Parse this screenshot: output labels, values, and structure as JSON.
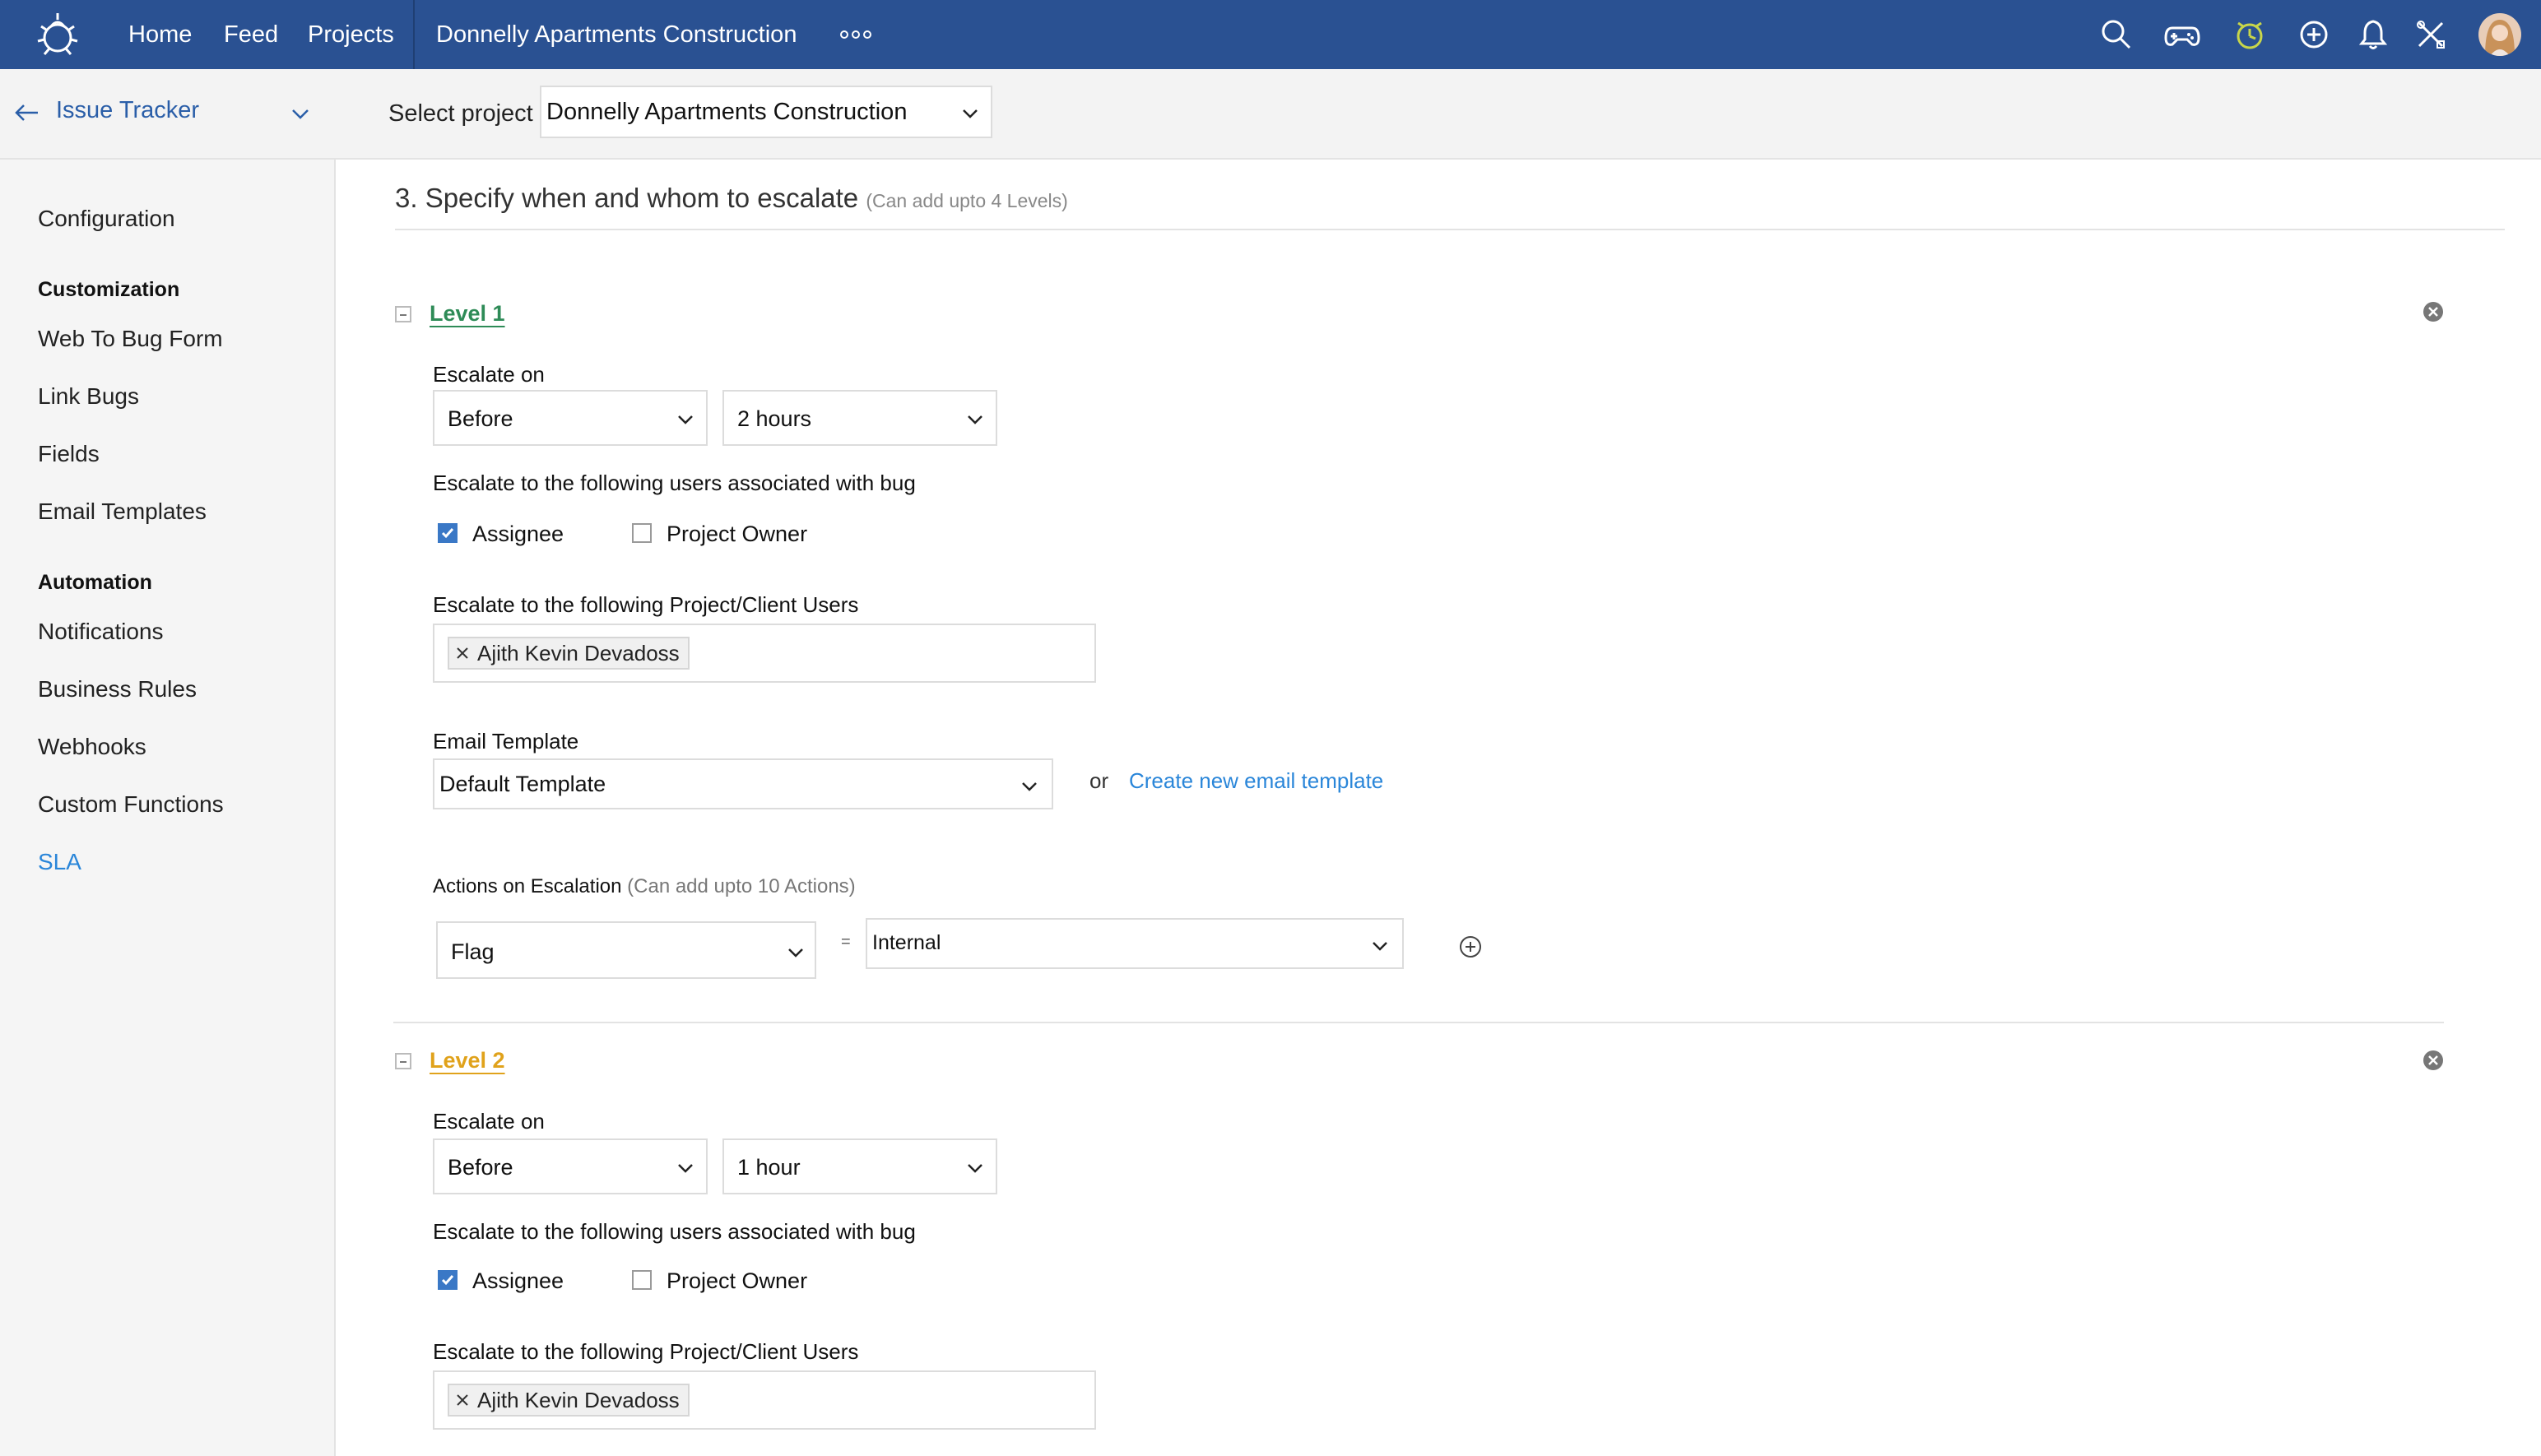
{
  "topbar": {
    "nav": [
      "Home",
      "Feed",
      "Projects"
    ],
    "project_title": "Donnelly Apartments Construction",
    "icons": [
      "search-icon",
      "gamepad-icon",
      "timer-icon",
      "add-icon",
      "bell-icon",
      "tools-icon",
      "avatar"
    ]
  },
  "subheader": {
    "tracker_label": "Issue Tracker",
    "select_label": "Select project",
    "selected_project": "Donnelly Apartments Construction"
  },
  "sidebar": {
    "configuration": "Configuration",
    "customization_heading": "Customization",
    "customization_items": [
      "Web To Bug Form",
      "Link Bugs",
      "Fields",
      "Email Templates"
    ],
    "automation_heading": "Automation",
    "automation_items": [
      "Notifications",
      "Business Rules",
      "Webhooks",
      "Custom Functions",
      "SLA"
    ],
    "active": "SLA"
  },
  "main": {
    "section_title": "3. Specify when and whom to escalate",
    "section_note": "(Can add upto 4 Levels)",
    "levels": [
      {
        "title": "Level 1",
        "color": "#2e8b57",
        "escalate_on_label": "Escalate on",
        "timing": "Before",
        "duration": "2 hours",
        "users_label": "Escalate to the following users associated with bug",
        "assignee_label": "Assignee",
        "assignee_checked": true,
        "owner_label": "Project Owner",
        "owner_checked": false,
        "client_users_label": "Escalate to the following Project/Client Users",
        "client_users": [
          "Ajith Kevin Devadoss"
        ],
        "email_template_label": "Email Template",
        "email_template": "Default Template",
        "or_text": "or",
        "create_template_link": "Create new email template",
        "actions_label": "Actions on Escalation",
        "actions_note": "(Can add upto 10 Actions)",
        "action_field": "Flag",
        "equals": "=",
        "action_value": "Internal"
      },
      {
        "title": "Level 2",
        "color": "#e0a21b",
        "escalate_on_label": "Escalate on",
        "timing": "Before",
        "duration": "1 hour",
        "users_label": "Escalate to the following users associated with bug",
        "assignee_label": "Assignee",
        "assignee_checked": true,
        "owner_label": "Project Owner",
        "owner_checked": false,
        "client_users_label": "Escalate to the following Project/Client Users",
        "client_users": [
          "Ajith Kevin Devadoss"
        ]
      }
    ]
  }
}
